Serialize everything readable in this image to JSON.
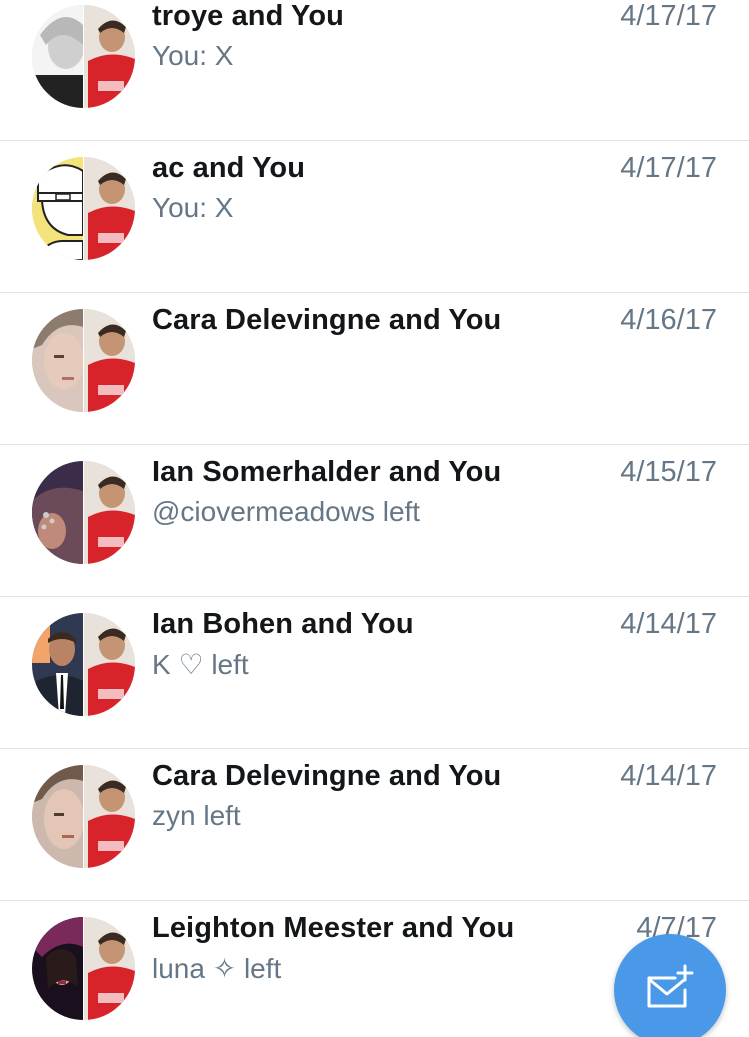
{
  "conversations": [
    {
      "title": "troye and You",
      "preview": "You: X",
      "date": "4/17/17"
    },
    {
      "title": "ac and You",
      "preview": "You: X",
      "date": "4/17/17"
    },
    {
      "title": "Cara Delevingne and You",
      "preview": "",
      "date": "4/16/17"
    },
    {
      "title": "Ian Somerhalder and You",
      "preview": "@ciovermeadows left",
      "date": "4/15/17"
    },
    {
      "title": "Ian Bohen and You",
      "preview": "K ♡ left",
      "date": "4/14/17"
    },
    {
      "title": "Cara Delevingne and You",
      "preview": "zyn left",
      "date": "4/14/17"
    },
    {
      "title": "Leighton Meester and You",
      "preview": "luna ✧ left",
      "date": "4/7/17"
    }
  ],
  "compose": {
    "icon": "new-message-icon"
  },
  "colors": {
    "accent": "#4a99e9",
    "title": "#14171a",
    "secondary": "#657786",
    "divider": "#dfe3e7"
  }
}
